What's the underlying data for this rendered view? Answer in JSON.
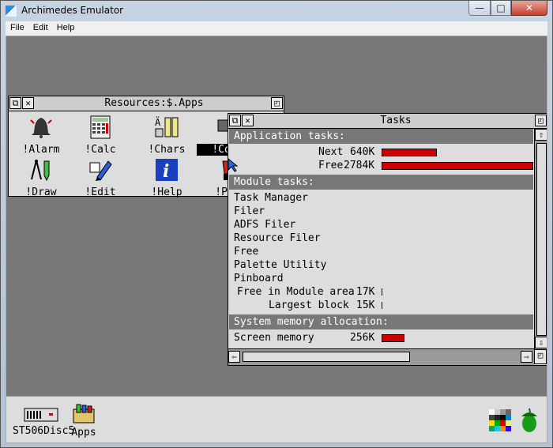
{
  "app": {
    "title": "Archimedes Emulator",
    "minimize": "—",
    "maximize": "□",
    "close": "✕"
  },
  "menu": [
    "File",
    "Edit",
    "Help"
  ],
  "resources_window": {
    "title": "Resources:$.Apps",
    "icons": [
      {
        "label": "!Alarm",
        "icon": "bell-icon"
      },
      {
        "label": "!Calc",
        "icon": "calculator-icon"
      },
      {
        "label": "!Chars",
        "icon": "chars-icon"
      },
      {
        "label": "!Con",
        "icon": "configure-icon"
      },
      {
        "label": "!Draw",
        "icon": "draw-icon"
      },
      {
        "label": "!Edit",
        "icon": "edit-icon"
      },
      {
        "label": "!Help",
        "icon": "help-icon"
      },
      {
        "label": "!Pa",
        "icon": "paint-icon"
      }
    ]
  },
  "tasks_window": {
    "title": "Tasks",
    "app_section": "Application tasks:",
    "next_label": "Next",
    "next_value": "640K",
    "next_fraction": 0.36,
    "free_label": "Free",
    "free_value": "2784K",
    "free_fraction": 1.0,
    "module_section": "Module tasks:",
    "modules": [
      "Task Manager",
      "Filer",
      "ADFS Filer",
      "Resource Filer",
      "Free",
      "Palette Utility",
      "Pinboard"
    ],
    "free_module_label": "Free in Module area",
    "free_module_value": "17K",
    "largest_label": "Largest block",
    "largest_value": "15K",
    "system_section": "System memory allocation:",
    "screen_label": "Screen memory",
    "screen_value": "256K",
    "screen_fraction": 0.14
  },
  "iconbar": {
    "disc_label": "ST506Disc5",
    "apps_label": "Apps"
  },
  "colors": {
    "desktop": "#777777",
    "window_bg": "#dddddd",
    "bar": "#cc0000"
  }
}
